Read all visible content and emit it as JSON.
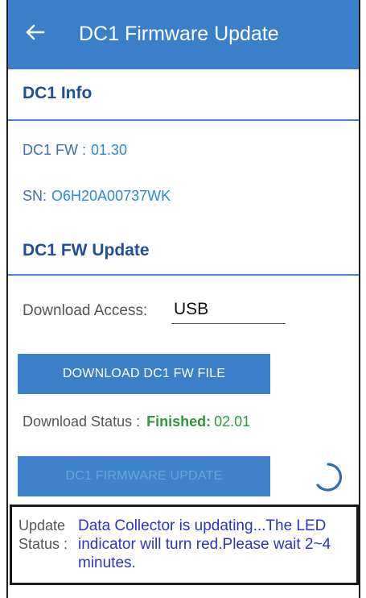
{
  "appbar": {
    "title": "DC1 Firmware Update"
  },
  "info": {
    "section_title": "DC1 Info",
    "fw_label": "DC1 FW :",
    "fw_value": "01.30",
    "sn_label": "SN:",
    "sn_value": "O6H20A00737WK"
  },
  "fw_update": {
    "section_title": "DC1 FW Update",
    "access_label": "Download Access:",
    "access_value": "USB",
    "download_button": "DOWNLOAD DC1 FW FILE",
    "status_label": "Download Status :",
    "status_value": "Finished:",
    "status_version": "02.01",
    "update_button": "DC1 FIRMWARE UPDATE"
  },
  "update_status": {
    "label": "Update Status :",
    "message": "Data Collector is updating...The LED indicator will turn red.Please wait 2~4 minutes."
  },
  "colors": {
    "appbar": "#3a80c8",
    "section_title": "#1f4f98",
    "finished": "#2a9a3a",
    "message": "#2a35c8"
  },
  "icons": {
    "back": "arrow-left-icon",
    "loading": "loading-spinner-icon"
  }
}
